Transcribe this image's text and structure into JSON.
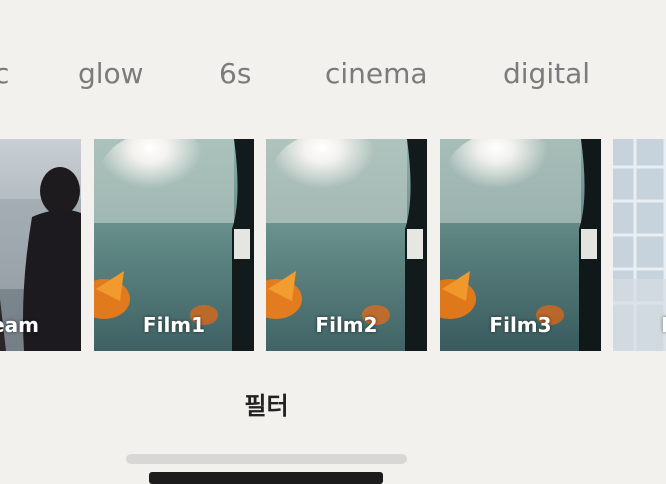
{
  "categories": [
    {
      "label": "c",
      "state": "partially-visible"
    },
    {
      "label": "glow"
    },
    {
      "label": "6s"
    },
    {
      "label": "cinema"
    },
    {
      "label": "digital"
    }
  ],
  "filters": [
    {
      "label": "eam",
      "image": "person-by-window",
      "state": "partially-visible"
    },
    {
      "label": "Film1",
      "image": "goldfish-in-bag"
    },
    {
      "label": "Film2",
      "image": "goldfish-in-bag"
    },
    {
      "label": "Film3",
      "image": "goldfish-in-bag"
    },
    {
      "label": "F",
      "image": "window-grid",
      "state": "partially-visible"
    }
  ],
  "panel": {
    "title": "필터"
  },
  "colors": {
    "background": "#f2f1ee",
    "category_text": "#7b7b7b",
    "title_text": "#222222",
    "scroll_track": "#d8d7d5",
    "home_indicator": "#1c1c1c"
  }
}
